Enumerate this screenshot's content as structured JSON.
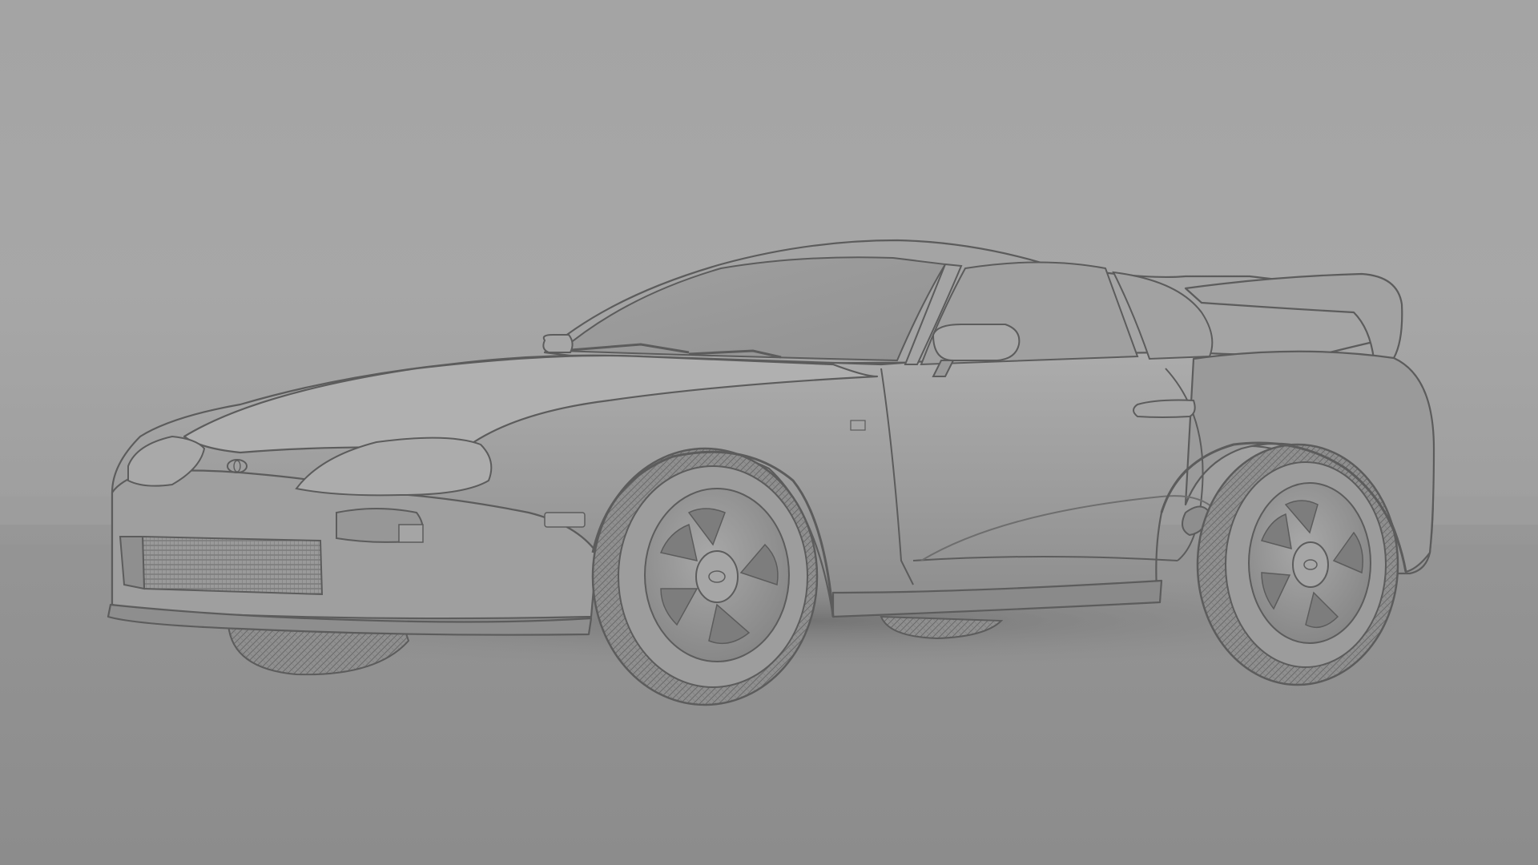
{
  "scene": {
    "subject": "sports-coupe-clay-render",
    "colors": {
      "sky_top": "#a9a9a9",
      "sky_horizon": "#9c9c9c",
      "floor_near": "#8a8a8a",
      "floor_far": "#939393",
      "body": "#9a9a9a",
      "body_highlight": "#adadad",
      "body_shadow": "#7c7c7c",
      "line": "#5c5c5c",
      "tire": "#8e8e8e",
      "shadow": "#6f6f6f"
    },
    "icons": {
      "front_badge": "toyota-emblem-icon",
      "wheel_badge": "toyota-emblem-icon"
    }
  }
}
